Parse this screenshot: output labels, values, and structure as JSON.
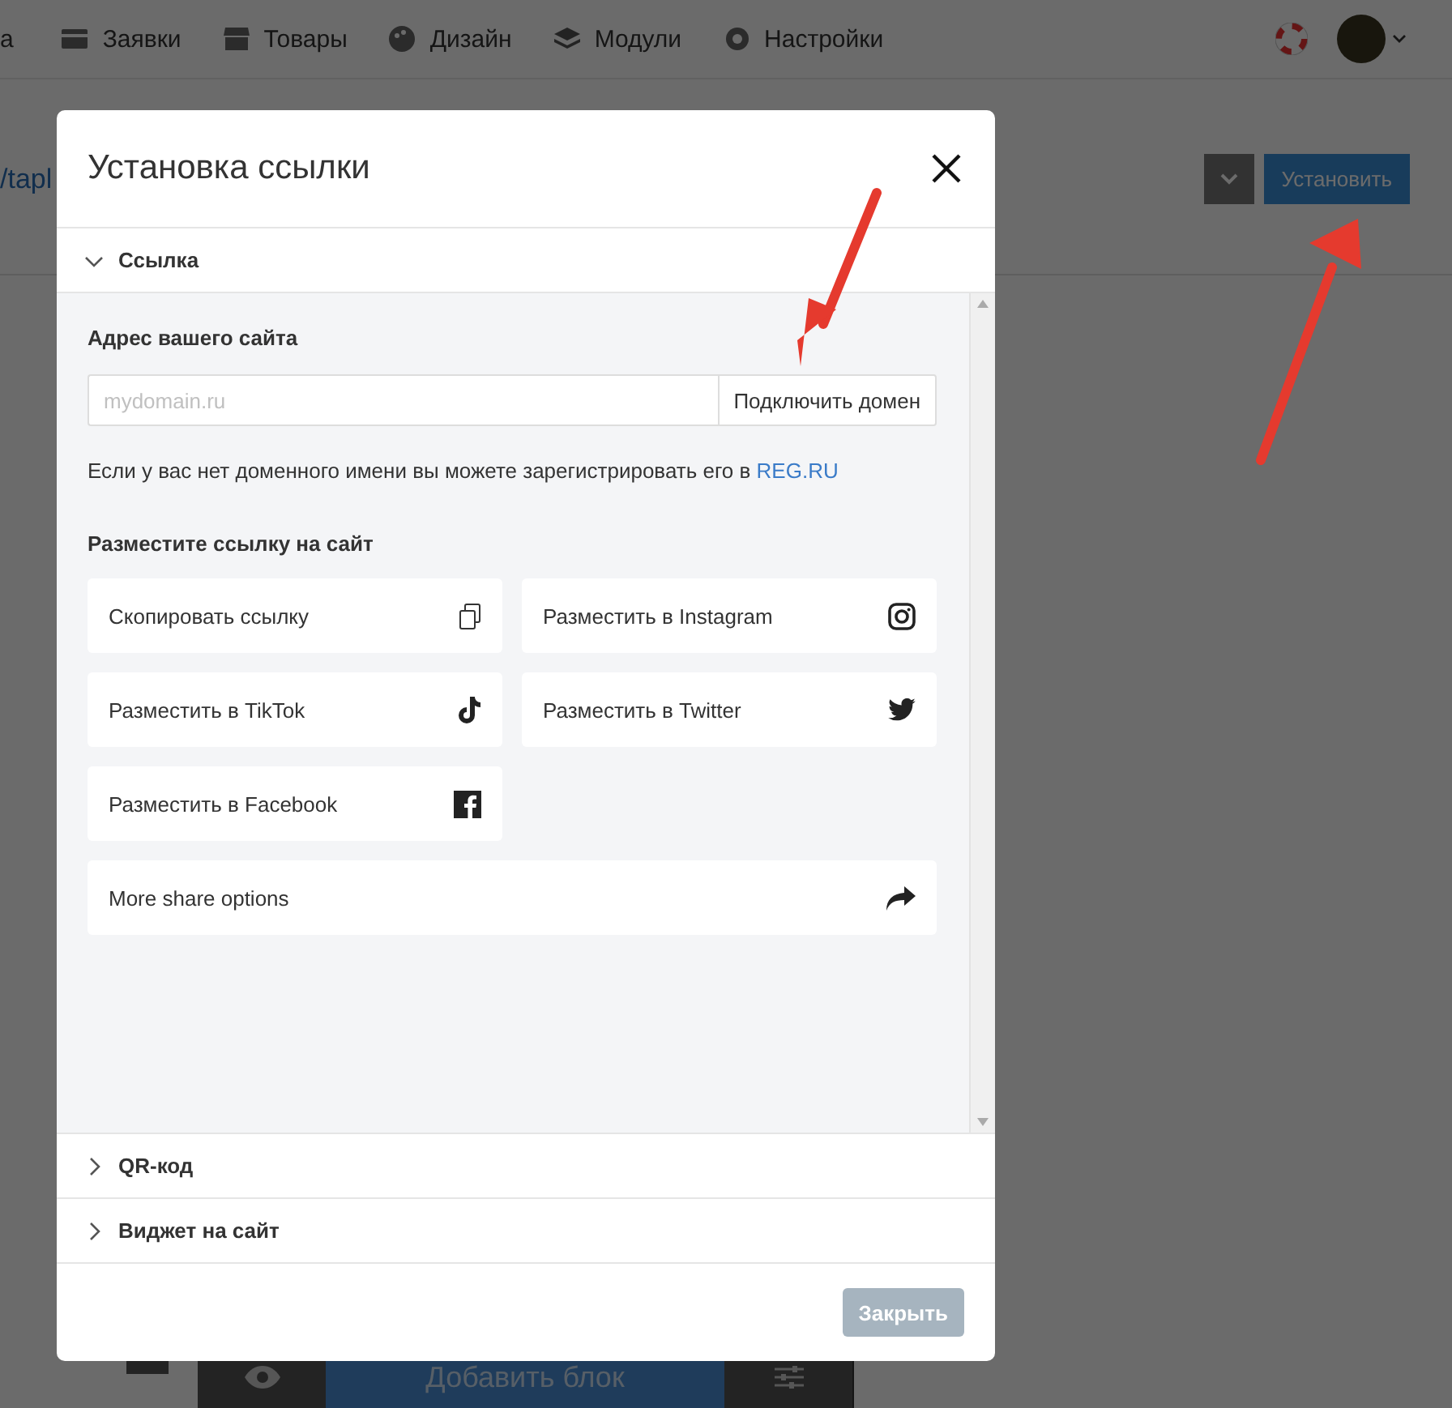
{
  "nav": {
    "items": [
      {
        "label": "а"
      },
      {
        "label": "Заявки"
      },
      {
        "label": "Товары"
      },
      {
        "label": "Дизайн"
      },
      {
        "label": "Модули"
      },
      {
        "label": "Настройки"
      }
    ]
  },
  "toolbar": {
    "link": "/tapl",
    "install_button": "Установить"
  },
  "editor_bar": {
    "add_block": "Добавить блок"
  },
  "modal": {
    "title": "Установка ссылки",
    "sections": [
      {
        "title": "Ссылка",
        "expanded": true
      },
      {
        "title": "QR-код",
        "expanded": false
      },
      {
        "title": "Виджет на сайт",
        "expanded": false
      }
    ],
    "address": {
      "label": "Адрес вашего сайта",
      "placeholder": "mydomain.ru",
      "button": "Подключить домен"
    },
    "hint": {
      "text": "Если у вас нет доменного имени вы можете зарегистрировать его в",
      "link": "REG.RU"
    },
    "share": {
      "heading": "Разместите ссылку на сайт",
      "options": [
        {
          "label": "Скопировать ссылку",
          "kind": "tile"
        },
        {
          "label": "Разместить в Instagram",
          "kind": "tile"
        },
        {
          "label": "Разместить в TikTok",
          "kind": "tile"
        },
        {
          "label": "Разместить в Twitter",
          "kind": "tile"
        },
        {
          "label": "Разместить в Facebook",
          "kind": "tile"
        },
        {
          "label": "More share options",
          "kind": "wide"
        }
      ]
    },
    "close_button": "Закрыть"
  }
}
